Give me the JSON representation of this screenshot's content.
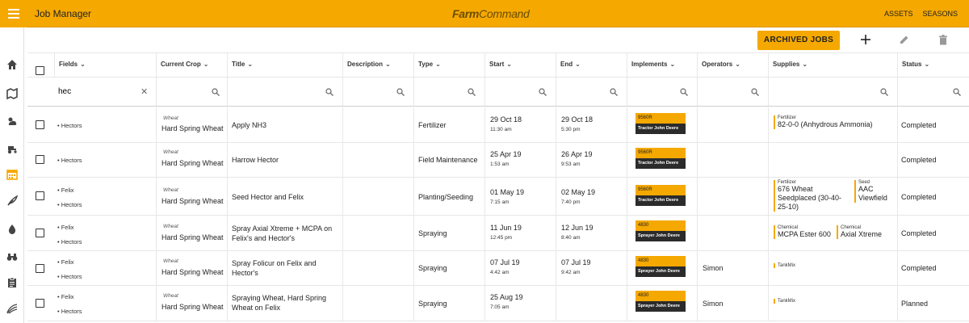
{
  "app": {
    "title": "Job Manager",
    "brand": "FarmCommand",
    "links": [
      "ASSETS",
      "SEASONS"
    ]
  },
  "toolbar": {
    "archived_label": "ARCHIVED JOBS",
    "icons": [
      "add-icon",
      "edit-icon",
      "delete-icon"
    ]
  },
  "rail_icons": [
    "home-icon",
    "map-icon",
    "weather-icon",
    "tractor-icon",
    "calendar-icon",
    "crop-icon",
    "water-drop-icon",
    "binoculars-icon",
    "clipboard-icon",
    "fields-icon"
  ],
  "columns": [
    "Fields",
    "Current Crop",
    "Title",
    "Description",
    "Type",
    "Start",
    "End",
    "Implements",
    "Operators",
    "Supplies",
    "Status"
  ],
  "filters": {
    "fields_value": "hec"
  },
  "rows": [
    {
      "fields": [
        "Hectors"
      ],
      "crop_type": "Wheat",
      "crop_variety": "Hard Spring Wheat",
      "title": "Apply NH3",
      "type": "Fertilizer",
      "start_date": "29 Oct 18",
      "start_time": "11:30 am",
      "end_date": "29 Oct 18",
      "end_time": "5:30 pm",
      "implement_name": "9560R",
      "implement_kind": "Tractor John Deere",
      "operator": "",
      "supplies": [
        {
          "type": "Fertilizer",
          "name": "82-0-0 (Anhydrous Ammonia)"
        }
      ],
      "status": "Completed"
    },
    {
      "fields": [
        "Hectors"
      ],
      "crop_type": "Wheat",
      "crop_variety": "Hard Spring Wheat",
      "title": "Harrow Hector",
      "type": "Field Maintenance",
      "start_date": "25 Apr 19",
      "start_time": "1:53 am",
      "end_date": "26 Apr 19",
      "end_time": "9:53 am",
      "implement_name": "9560R",
      "implement_kind": "Tractor John Deere",
      "operator": "",
      "supplies": [],
      "status": "Completed"
    },
    {
      "fields": [
        "Felix",
        "Hectors"
      ],
      "crop_type": "Wheat",
      "crop_variety": "Hard Spring Wheat",
      "title": "Seed Hector and Felix",
      "type": "Planting/Seeding",
      "start_date": "01 May 19",
      "start_time": "7:15 am",
      "end_date": "02 May 19",
      "end_time": "7:40 pm",
      "implement_name": "9560R",
      "implement_kind": "Tractor John Deere",
      "operator": "",
      "supplies": [
        {
          "type": "Fertilizer",
          "name": "676 Wheat Seedplaced (30-40-25-10)"
        },
        {
          "type": "Seed",
          "name": "AAC Viewfield"
        }
      ],
      "status": "Completed"
    },
    {
      "fields": [
        "Felix",
        "Hectors"
      ],
      "crop_type": "Wheat",
      "crop_variety": "Hard Spring Wheat",
      "title": "Spray Axial Xtreme + MCPA on Felix's and Hector's",
      "type": "Spraying",
      "start_date": "11 Jun 19",
      "start_time": "12:45 pm",
      "end_date": "12 Jun 19",
      "end_time": "8:40 am",
      "implement_name": "4830",
      "implement_kind": "Sprayer John Deere",
      "operator": "",
      "supplies": [
        {
          "type": "Chemical",
          "name": "MCPA Ester 600"
        },
        {
          "type": "Chemical",
          "name": "Axial Xtreme"
        }
      ],
      "status": "Completed"
    },
    {
      "fields": [
        "Felix",
        "Hectors"
      ],
      "crop_type": "Wheat",
      "crop_variety": "Hard Spring Wheat",
      "title": "Spray Folicur on Felix and Hector's",
      "type": "Spraying",
      "start_date": "07 Jul 19",
      "start_time": "4:42 am",
      "end_date": "07 Jul 19",
      "end_time": "9:42 am",
      "implement_name": "4830",
      "implement_kind": "Sprayer John Deere",
      "operator": "Simon",
      "supplies": [
        {
          "type": "TankMix",
          "name": ""
        }
      ],
      "status": "Completed"
    },
    {
      "fields": [
        "Felix",
        "Hectors"
      ],
      "crop_type": "Wheat",
      "crop_variety": "Hard Spring Wheat",
      "title": "Spraying Wheat, Hard Spring Wheat on Felix",
      "type": "Spraying",
      "start_date": "25 Aug 19",
      "start_time": "7:05 am",
      "end_date": "",
      "end_time": "",
      "implement_name": "4830",
      "implement_kind": "Sprayer John Deere",
      "operator": "Simon",
      "supplies": [
        {
          "type": "TankMix",
          "name": ""
        }
      ],
      "status": "Planned"
    }
  ]
}
